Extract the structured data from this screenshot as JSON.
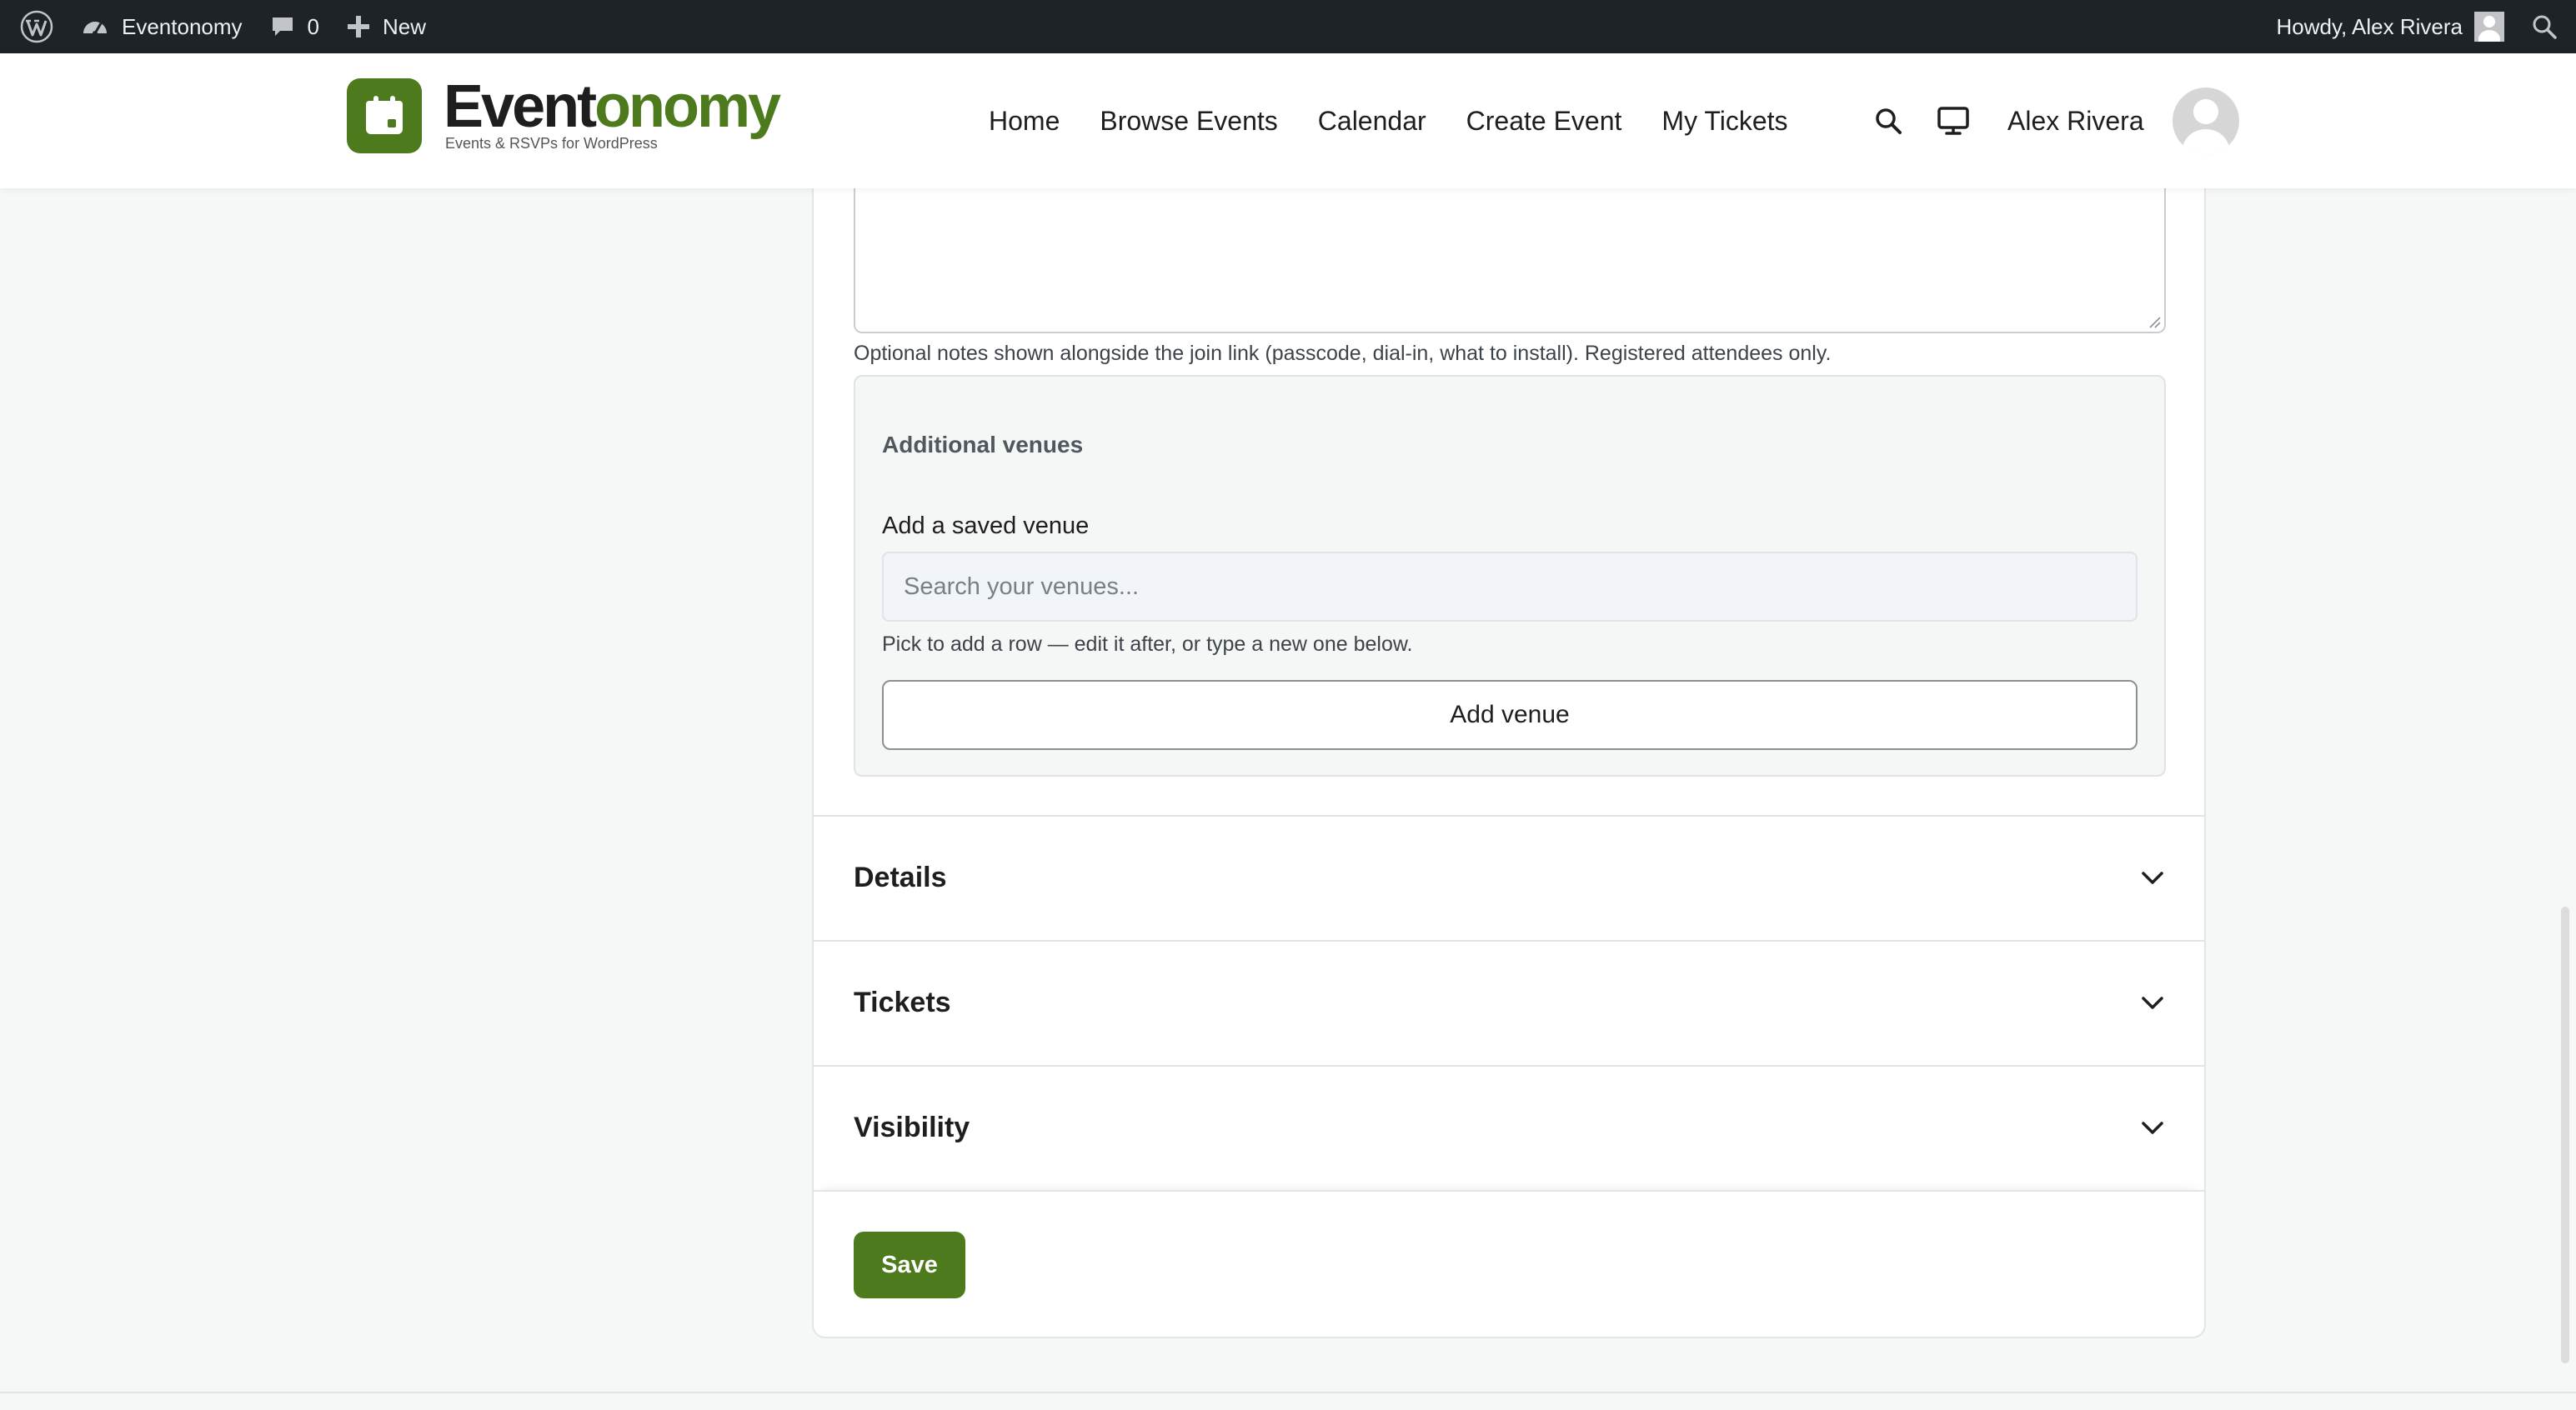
{
  "adminbar": {
    "site_name": "Eventonomy",
    "comments_count": "0",
    "new_label": "New",
    "howdy": "Howdy, Alex Rivera"
  },
  "header": {
    "logo_word_a": "Event",
    "logo_word_b": "onomy",
    "logo_tagline": "Events & RSVPs for WordPress",
    "nav": [
      "Home",
      "Browse Events",
      "Calendar",
      "Create Event",
      "My Tickets"
    ],
    "user_name": "Alex Rivera",
    "icons": [
      "search-icon",
      "monitor-icon",
      "avatar"
    ]
  },
  "form": {
    "notes_help": "Optional notes shown alongside the join link (passcode, dial-in, what to install). Registered attendees only.",
    "venues": {
      "heading": "Additional venues",
      "label": "Add a saved venue",
      "placeholder": "Search your venues...",
      "help": "Pick to add a row — edit it after, or type a new one below.",
      "add_button": "Add venue"
    },
    "sections": [
      "Details",
      "Tickets",
      "Visibility"
    ],
    "save_label": "Save"
  },
  "colors": {
    "brand": "#4d7a1c",
    "adminbar": "#1d2327",
    "background": "#f6f7f7"
  }
}
